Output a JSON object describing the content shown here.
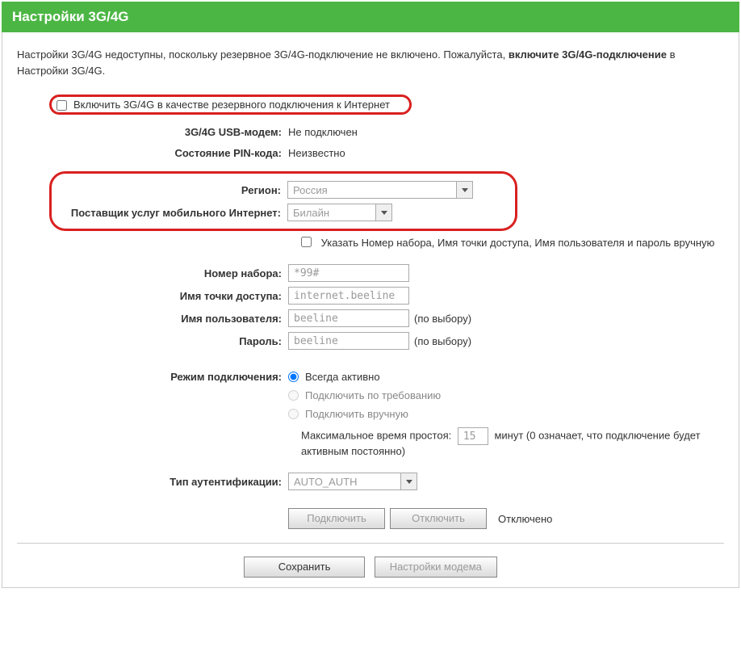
{
  "header": {
    "title": "Настройки 3G/4G"
  },
  "notice": {
    "part1": "Настройки 3G/4G недоступны, поскольку резервное 3G/4G-подключение не включено. Пожалуйста, ",
    "bold": "включите 3G/4G-подключение",
    "part2": " в Настройки 3G/4G."
  },
  "enableBackup": {
    "label": "Включить 3G/4G в качестве резервного подключения к Интернет"
  },
  "usbModem": {
    "label": "3G/4G USB-модем:",
    "value": "Не подключен"
  },
  "pin": {
    "label": "Состояние PIN-кода:",
    "value": "Неизвестно"
  },
  "region": {
    "label": "Регион:",
    "value": "Россия"
  },
  "provider": {
    "label": "Поставщик услуг мобильного Интернет:",
    "value": "Билайн"
  },
  "manual": {
    "label": "Указать Номер набора, Имя точки доступа, Имя пользователя и пароль вручную"
  },
  "dial": {
    "label": "Номер набора:",
    "value": "*99#"
  },
  "apn": {
    "label": "Имя точки доступа:",
    "value": "internet.beeline"
  },
  "username": {
    "label": "Имя пользователя:",
    "value": "beeline",
    "suffix": "(по выбору)"
  },
  "password": {
    "label": "Пароль:",
    "value": "beeline",
    "suffix": "(по выбору)"
  },
  "connMode": {
    "label": "Режим подключения:",
    "opt1": "Всегда активно",
    "opt2": "Подключить по требованию",
    "opt3": "Подключить вручную"
  },
  "idle": {
    "prefix": "Максимальное время простоя:",
    "value": "15",
    "suffix": "минут (0 означает, что подключение будет активным постоянно)"
  },
  "auth": {
    "label": "Тип аутентификации:",
    "value": "AUTO_AUTH"
  },
  "btns": {
    "connect": "Подключить",
    "disconnect": "Отключить",
    "status": "Отключено",
    "save": "Сохранить",
    "modemSettings": "Настройки модема"
  }
}
